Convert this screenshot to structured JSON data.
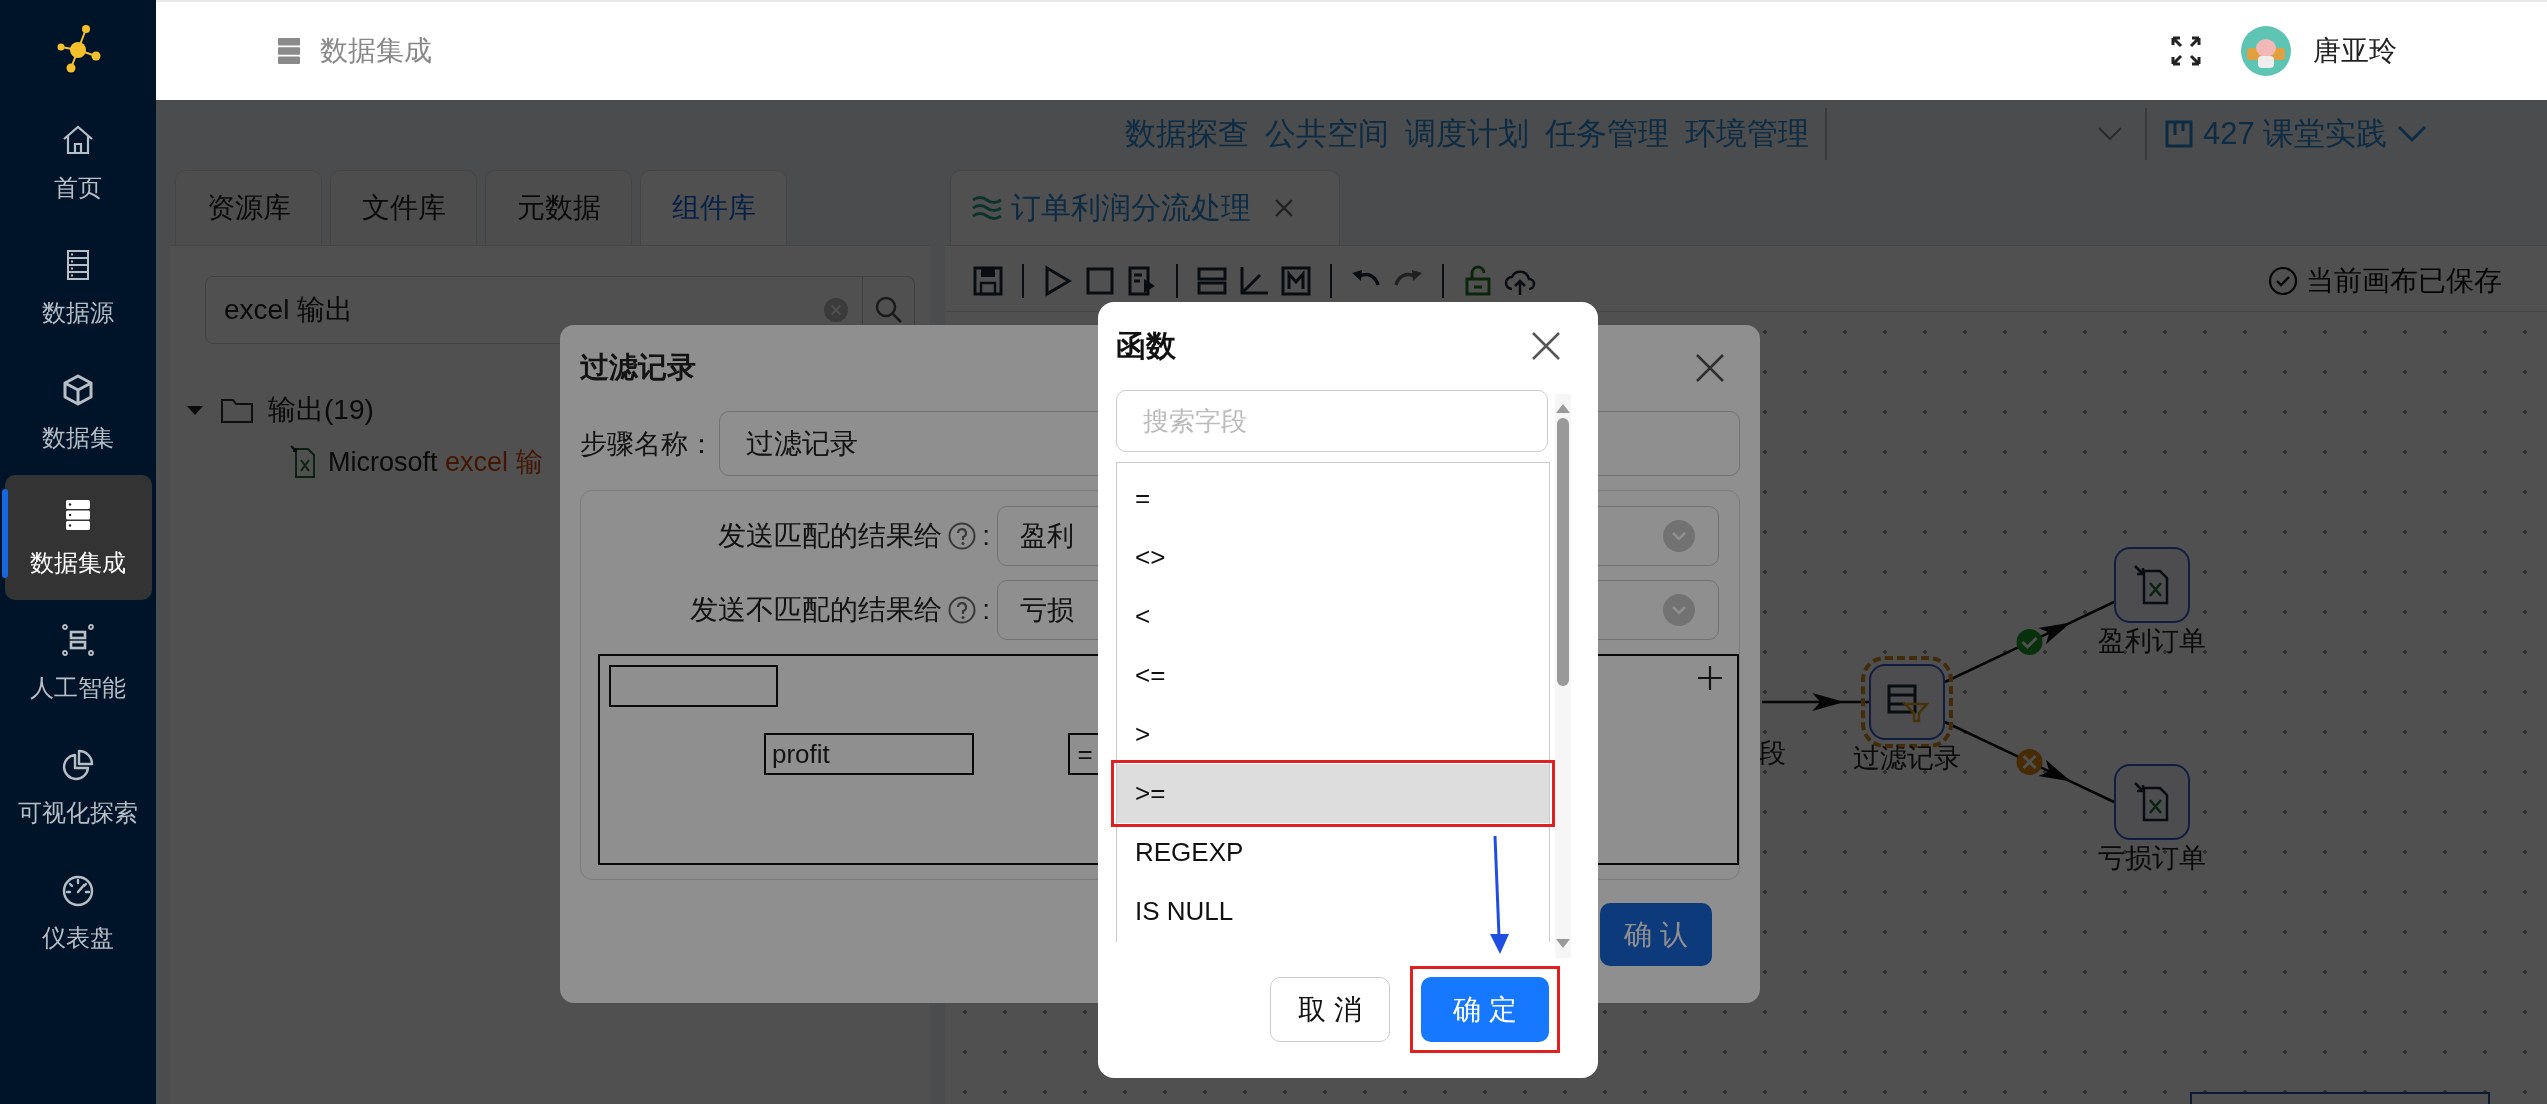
{
  "sidebar": {
    "items": [
      {
        "label": "首页",
        "selected": false
      },
      {
        "label": "数据源",
        "selected": false
      },
      {
        "label": "数据集",
        "selected": false
      },
      {
        "label": "数据集成",
        "selected": true
      },
      {
        "label": "人工智能",
        "selected": false
      },
      {
        "label": "可视化探索",
        "selected": false
      },
      {
        "label": "仪表盘",
        "selected": false
      }
    ]
  },
  "header": {
    "breadcrumb": "数据集成",
    "user": {
      "name": "唐亚玲"
    }
  },
  "top_nav": {
    "links": [
      "数据探查",
      "公共空间",
      "调度计划",
      "任务管理",
      "环境管理"
    ],
    "project": "427 课堂实践"
  },
  "library": {
    "tabs": [
      {
        "label": "资源库",
        "selected": false
      },
      {
        "label": "文件库",
        "selected": false
      },
      {
        "label": "元数据",
        "selected": false
      },
      {
        "label": "组件库",
        "selected": true
      }
    ],
    "search": {
      "value": "excel 输出"
    },
    "tree": [
      {
        "label": "输出(19)",
        "expanded": true,
        "children": [
          {
            "label": "Microsoft",
            "highlight": "excel 输"
          }
        ]
      }
    ]
  },
  "editor": {
    "tabs": [
      {
        "label": "订单利润分流处理",
        "selected": true
      }
    ],
    "status": "当前画布已保存",
    "canvas": {
      "nodes": [
        {
          "label": "段",
          "kind": "label"
        },
        {
          "label": "过滤记录",
          "kind": "filter",
          "selected": true
        },
        {
          "label": "盈利订单",
          "kind": "excel",
          "selected": false
        },
        {
          "label": "亏损订单",
          "kind": "excel",
          "selected": false
        }
      ],
      "edges": [
        {
          "kind": "plain"
        },
        {
          "kind": "match"
        },
        {
          "kind": "mismatch"
        }
      ]
    }
  },
  "filter_dialog": {
    "title": "过滤记录",
    "step_name": {
      "label": "步骤名称：",
      "value": "过滤记录"
    },
    "targets": [
      {
        "label": "发送匹配的结果给",
        "colon": ":",
        "value": "盈利"
      },
      {
        "label": "发送不匹配的结果给",
        "colon": ":",
        "value": "亏损"
      }
    ],
    "condition": {
      "field": "profit",
      "operator": "="
    },
    "confirm": "确 认"
  },
  "function_dialog": {
    "title": "函数",
    "search": {
      "placeholder": "搜索字段"
    },
    "items": [
      {
        "label": "=",
        "selected": false,
        "annotated": false
      },
      {
        "label": "<>",
        "selected": false,
        "annotated": false
      },
      {
        "label": "<",
        "selected": false,
        "annotated": false
      },
      {
        "label": "<=",
        "selected": false,
        "annotated": false
      },
      {
        "label": ">",
        "selected": false,
        "annotated": false
      },
      {
        "label": ">=",
        "selected": true,
        "annotated": true
      },
      {
        "label": "REGEXP",
        "selected": false,
        "annotated": false
      },
      {
        "label": "IS NULL",
        "selected": false,
        "annotated": false
      }
    ],
    "buttons": [
      {
        "label": "取 消",
        "kind": "default",
        "annotated": false
      },
      {
        "label": "确 定",
        "kind": "primary",
        "annotated": true
      }
    ],
    "annotation_arrow": true
  }
}
